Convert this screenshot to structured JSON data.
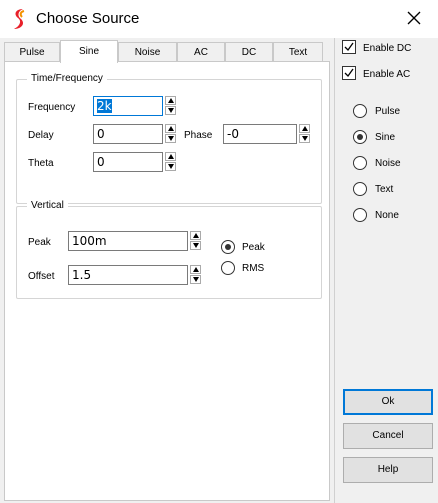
{
  "window": {
    "title": "Choose Source",
    "icon": "app-logo-icon",
    "close_icon": "close-icon"
  },
  "tabs": [
    {
      "label": "Pulse",
      "active": false
    },
    {
      "label": "Sine",
      "active": true
    },
    {
      "label": "Noise",
      "active": false
    },
    {
      "label": "AC",
      "active": false
    },
    {
      "label": "DC",
      "active": false
    },
    {
      "label": "Text",
      "active": false
    }
  ],
  "time_frequency": {
    "title": "Time/Frequency",
    "frequency": {
      "label": "Frequency",
      "value": "2k"
    },
    "delay": {
      "label": "Delay",
      "value": "0"
    },
    "phase": {
      "label": "Phase",
      "value": "-0"
    },
    "theta": {
      "label": "Theta",
      "value": "0"
    }
  },
  "vertical": {
    "title": "Vertical",
    "peak": {
      "label": "Peak",
      "value": "100m"
    },
    "offset": {
      "label": "Offset",
      "value": "1.5"
    },
    "mode_options": [
      {
        "label": "Peak",
        "selected": true
      },
      {
        "label": "RMS",
        "selected": false
      }
    ]
  },
  "checkboxes": [
    {
      "label": "Enable DC",
      "checked": true
    },
    {
      "label": "Enable AC",
      "checked": true
    }
  ],
  "source_types": [
    {
      "label": "Pulse",
      "selected": false
    },
    {
      "label": "Sine",
      "selected": true
    },
    {
      "label": "Noise",
      "selected": false
    },
    {
      "label": "Text",
      "selected": false
    },
    {
      "label": "None",
      "selected": false
    }
  ],
  "buttons": {
    "ok": "Ok",
    "cancel": "Cancel",
    "help": "Help"
  },
  "colors": {
    "accent": "#0078d7",
    "logo_red": "#e8202a",
    "logo_orange": "#f39200"
  }
}
